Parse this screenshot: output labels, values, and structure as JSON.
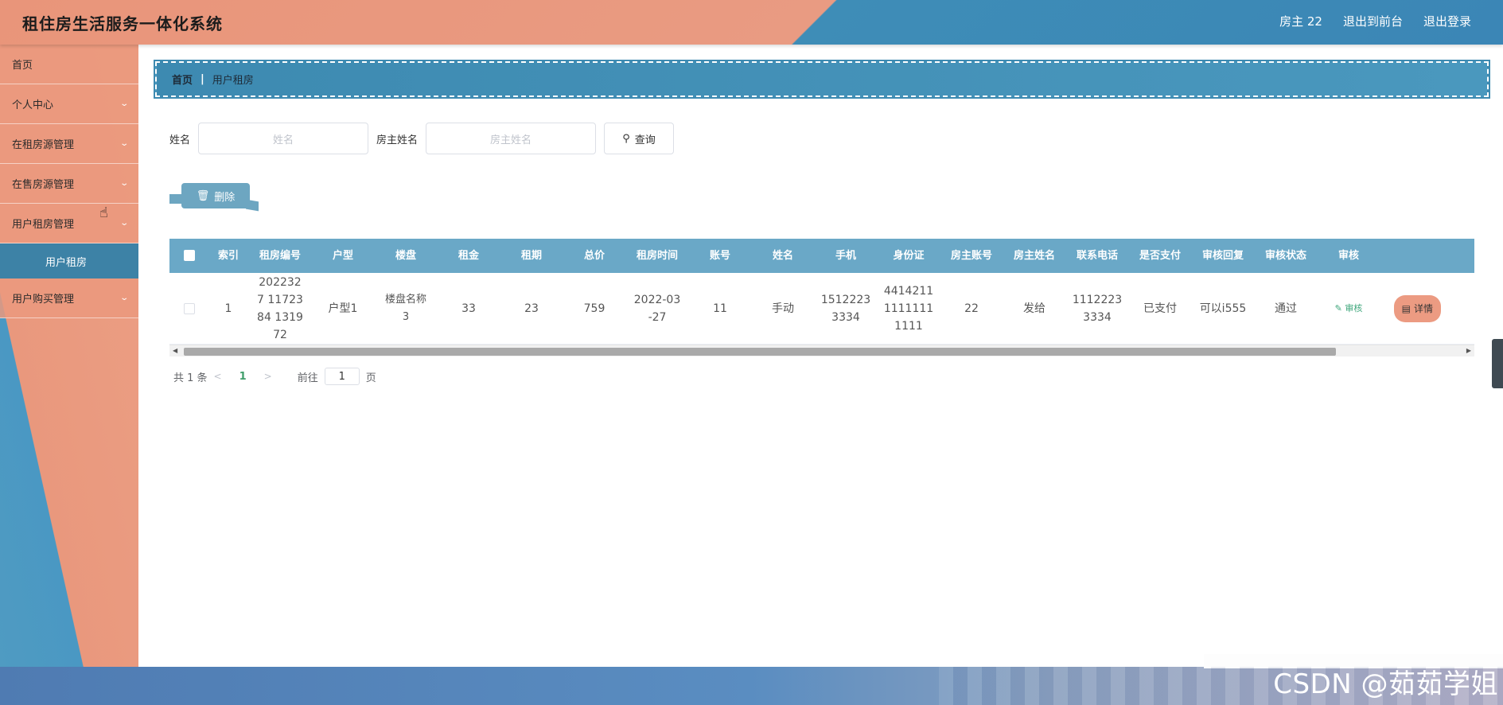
{
  "header": {
    "title": "租住房生活服务一体化系统",
    "user": "房主 22",
    "to_front": "退出到前台",
    "logout": "退出登录"
  },
  "sidebar": {
    "items": [
      {
        "label": "首页",
        "has_children": false
      },
      {
        "label": "个人中心",
        "has_children": true
      },
      {
        "label": "在租房源管理",
        "has_children": true
      },
      {
        "label": "在售房源管理",
        "has_children": true
      },
      {
        "label": "用户租房管理",
        "has_children": true
      },
      {
        "label": "用户租房",
        "is_sub": true,
        "active": true
      },
      {
        "label": "用户购买管理",
        "has_children": true
      }
    ]
  },
  "breadcrumb": {
    "home": "首页",
    "current": "用户租房"
  },
  "search": {
    "name_label": "姓名",
    "name_placeholder": "姓名",
    "owner_label": "房主姓名",
    "owner_placeholder": "房主姓名",
    "query_label": "查询"
  },
  "actions": {
    "delete_label": "删除"
  },
  "table": {
    "columns": [
      "索引",
      "租房编号",
      "户型",
      "楼盘",
      "租金",
      "租期",
      "总价",
      "租房时间",
      "账号",
      "姓名",
      "手机",
      "身份证",
      "房主账号",
      "房主姓名",
      "联系电话",
      "是否支付",
      "审核回复",
      "审核状态",
      "审核"
    ],
    "rows": [
      {
        "index": "1",
        "rent_no": "2022327 1172384 131972",
        "house_type": "户型1",
        "building": "楼盘名称 3",
        "rent": "33",
        "period": "23",
        "total": "759",
        "rent_time": "2022-03 -27",
        "account": "11",
        "name": "手动",
        "phone": "1512223 3334",
        "id_card": "4414211 1111111 1111",
        "owner_account": "22",
        "owner_name": "发给",
        "contact": "1112223 3334",
        "paid": "已支付",
        "reply": "可以i555",
        "status": "通过",
        "audit_link": "审核",
        "detail_label": "详情"
      }
    ]
  },
  "pagination": {
    "total_text": "共 1 条",
    "current_page": "1",
    "goto_prefix": "前往",
    "goto_value": "1",
    "goto_suffix": "页"
  },
  "watermark": "CSDN @茹茹学姐",
  "colors": {
    "accent_orange": "#e9957a",
    "accent_blue": "#3d8ab1",
    "table_header": "#6aa8c7",
    "link_green": "#3ea67b"
  }
}
